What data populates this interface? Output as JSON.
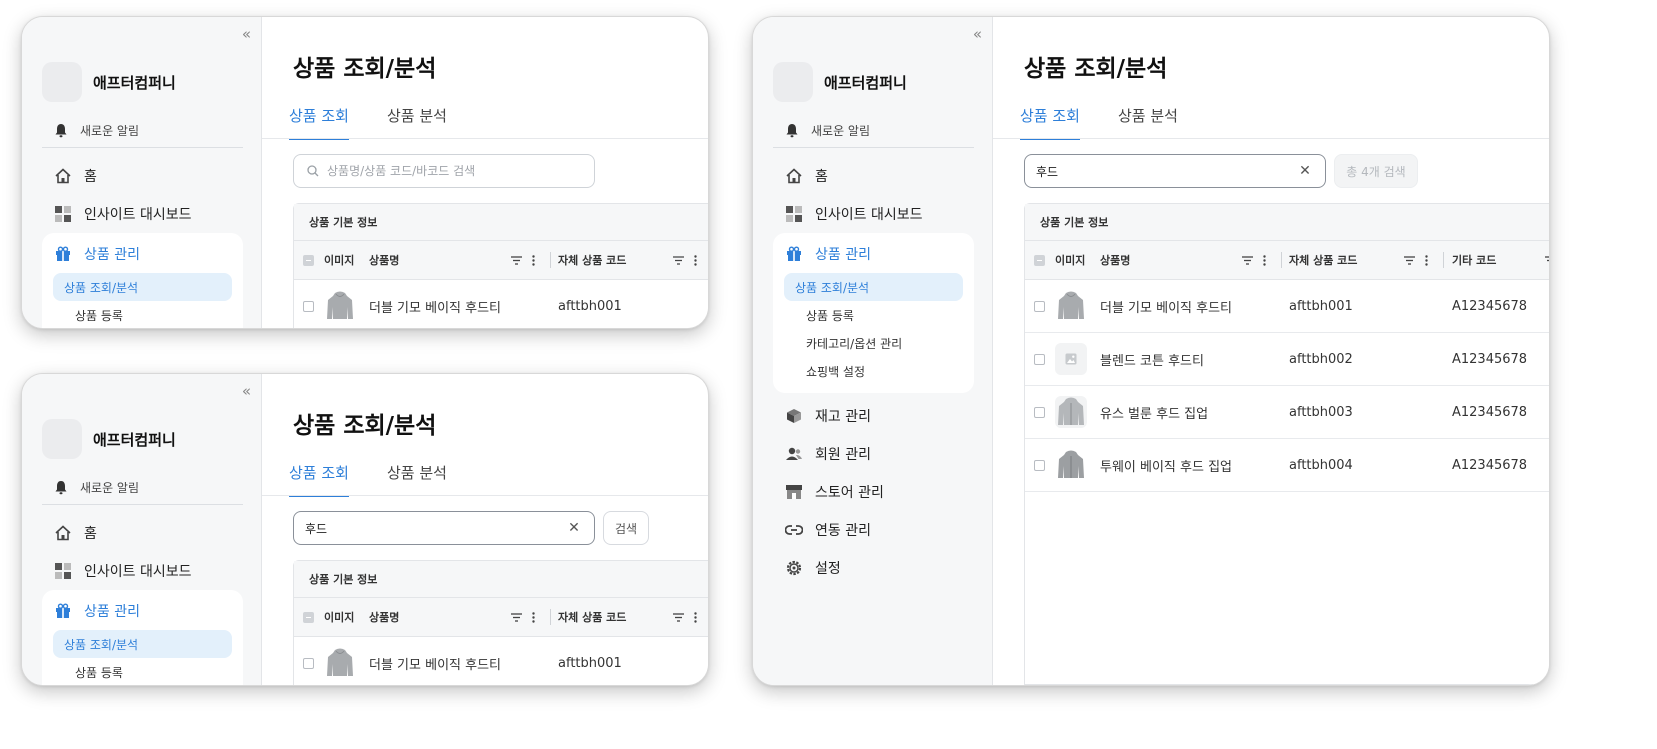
{
  "brand": {
    "name": "애프터컴퍼니"
  },
  "sidebar": {
    "notification": "새로운 알림",
    "nav": [
      {
        "label": "홈",
        "icon": "home-icon"
      },
      {
        "label": "인사이트 대시보드",
        "icon": "dashboard-icon"
      }
    ],
    "group": {
      "label": "상품 관리",
      "icon": "gift-icon",
      "subitems": [
        "상품 조회/분석",
        "상품 등록",
        "카테고리/옵션 관리",
        "쇼핑백 설정"
      ]
    },
    "nav_after": [
      {
        "label": "재고 관리",
        "icon": "box-icon"
      },
      {
        "label": "회원 관리",
        "icon": "users-icon"
      },
      {
        "label": "스토어 관리",
        "icon": "store-icon"
      },
      {
        "label": "연동 관리",
        "icon": "link-icon"
      },
      {
        "label": "설정",
        "icon": "gear-icon"
      }
    ]
  },
  "page": {
    "title": "상품 조회/분석",
    "tabs": [
      {
        "label": "상품 조회",
        "active": true
      },
      {
        "label": "상품 분석",
        "active": false
      }
    ]
  },
  "search": {
    "placeholder": "상품명/상품 코드/바코드 검색",
    "query": "후드",
    "button_label": "검색",
    "result_label": "총 4개 검색"
  },
  "table": {
    "group_header": "상품 기본 정보",
    "columns": [
      "이미지",
      "상품명",
      "자체 상품 코드",
      "기타 코드"
    ],
    "rows": [
      {
        "name": "더블 기모 베이직 후드티",
        "code": "afttbh001",
        "etc": "A12345678",
        "thumb": "hoodie"
      },
      {
        "name": "블렌드 코튼 후드티",
        "code": "afttbh002",
        "etc": "A12345678",
        "thumb": "placeholder"
      },
      {
        "name": "유스 벌룬 후드 집업",
        "code": "afttbh003",
        "etc": "A12345678",
        "thumb": "hoodie"
      },
      {
        "name": "투웨이 베이직 후드 집업",
        "code": "afttbh004",
        "etc": "A12345678",
        "thumb": "hoodie"
      }
    ]
  },
  "colors": {
    "accent": "#2e7fd9",
    "active_bg": "#e3f0fb",
    "sidebar_bg": "#f6f7f8"
  }
}
